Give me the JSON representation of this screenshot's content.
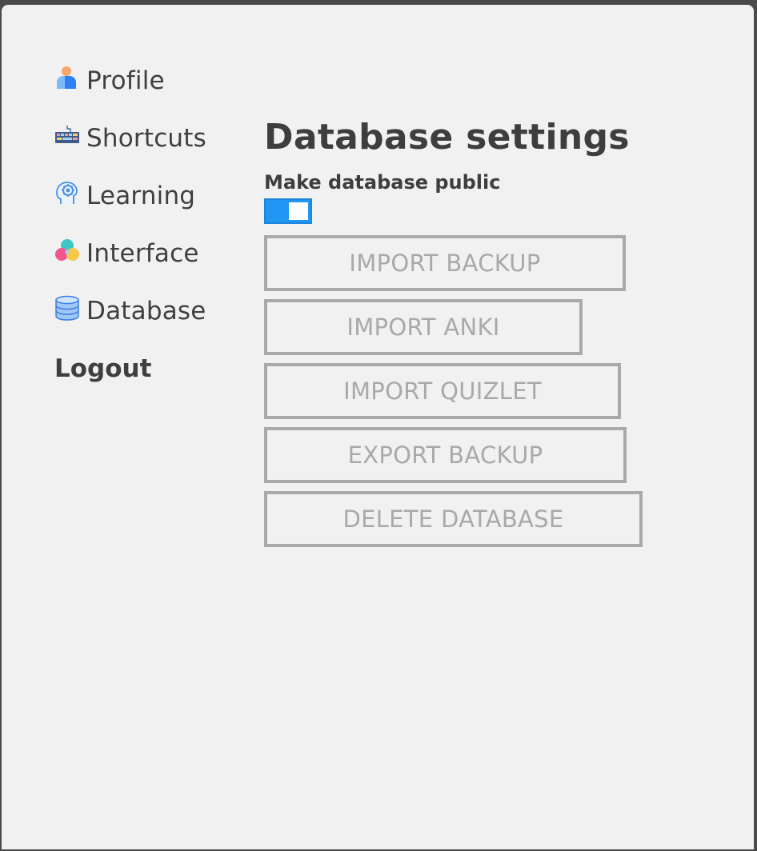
{
  "sidebar": {
    "items": [
      {
        "label": "Profile",
        "icon": "profile-icon"
      },
      {
        "label": "Shortcuts",
        "icon": "keyboard-icon"
      },
      {
        "label": "Learning",
        "icon": "brain-gear-icon"
      },
      {
        "label": "Interface",
        "icon": "color-circles-icon"
      },
      {
        "label": "Database",
        "icon": "database-icon"
      }
    ],
    "logout_label": "Logout"
  },
  "main": {
    "title": "Database settings",
    "public_label": "Make database public",
    "public_enabled": true,
    "buttons": {
      "import_backup": "IMPORT BACKUP",
      "import_anki": "IMPORT ANKI",
      "import_quizlet": "IMPORT QUIZLET",
      "export_backup": "EXPORT BACKUP",
      "delete_database": "DELETE DATABASE"
    }
  },
  "colors": {
    "accent": "#2196f3",
    "button_border": "#a9a9a9",
    "text": "#3e3e3e",
    "background": "#f1f1f1"
  }
}
